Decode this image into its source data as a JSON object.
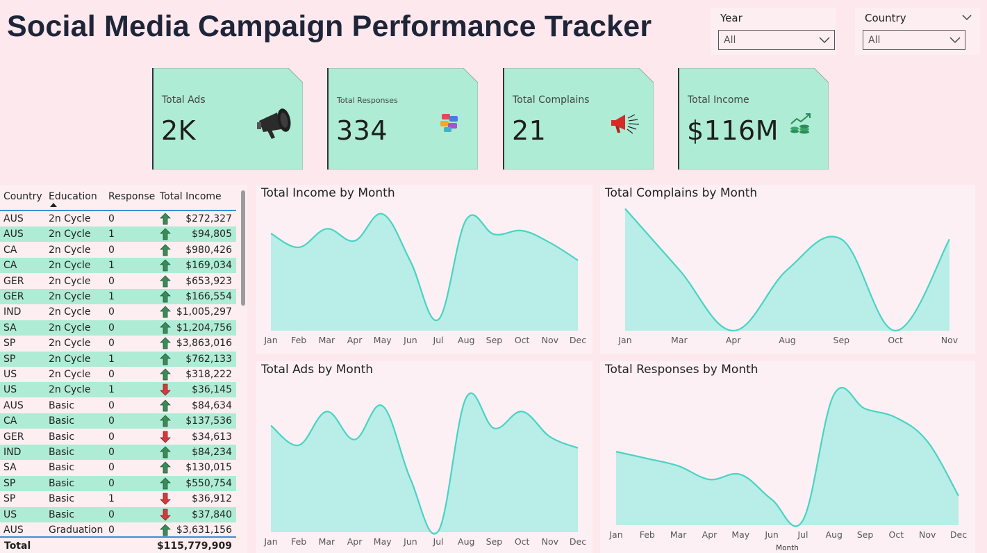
{
  "title": "Social Media Campaign Performance Tracker",
  "slicers": {
    "year": {
      "label": "Year",
      "value": "All"
    },
    "country": {
      "label": "Country",
      "value": "All"
    }
  },
  "kpis": [
    {
      "label": "Total Ads",
      "value": "2K",
      "icon": "megaphone-icon"
    },
    {
      "label": "Total Responses",
      "value": "334",
      "icon": "chat-bubbles-icon"
    },
    {
      "label": "Total Complains",
      "value": "21",
      "icon": "loudspeaker-icon"
    },
    {
      "label": "Total Income",
      "value": "$116M",
      "icon": "money-growth-icon"
    }
  ],
  "table": {
    "columns": [
      "Country",
      "Education",
      "Response",
      "Total Income"
    ],
    "rows": [
      {
        "country": "AUS",
        "education": "2n Cycle",
        "response": "0",
        "income": "$272,327",
        "trend": "up"
      },
      {
        "country": "AUS",
        "education": "2n Cycle",
        "response": "1",
        "income": "$94,805",
        "trend": "up"
      },
      {
        "country": "CA",
        "education": "2n Cycle",
        "response": "0",
        "income": "$980,426",
        "trend": "up"
      },
      {
        "country": "CA",
        "education": "2n Cycle",
        "response": "1",
        "income": "$169,034",
        "trend": "up"
      },
      {
        "country": "GER",
        "education": "2n Cycle",
        "response": "0",
        "income": "$653,923",
        "trend": "up"
      },
      {
        "country": "GER",
        "education": "2n Cycle",
        "response": "1",
        "income": "$166,554",
        "trend": "up"
      },
      {
        "country": "IND",
        "education": "2n Cycle",
        "response": "0",
        "income": "$1,005,297",
        "trend": "up"
      },
      {
        "country": "SA",
        "education": "2n Cycle",
        "response": "0",
        "income": "$1,204,756",
        "trend": "up"
      },
      {
        "country": "SP",
        "education": "2n Cycle",
        "response": "0",
        "income": "$3,863,016",
        "trend": "up"
      },
      {
        "country": "SP",
        "education": "2n Cycle",
        "response": "1",
        "income": "$762,133",
        "trend": "up"
      },
      {
        "country": "US",
        "education": "2n Cycle",
        "response": "0",
        "income": "$318,222",
        "trend": "up"
      },
      {
        "country": "US",
        "education": "2n Cycle",
        "response": "1",
        "income": "$36,145",
        "trend": "down"
      },
      {
        "country": "AUS",
        "education": "Basic",
        "response": "0",
        "income": "$84,634",
        "trend": "up"
      },
      {
        "country": "CA",
        "education": "Basic",
        "response": "0",
        "income": "$137,536",
        "trend": "up"
      },
      {
        "country": "GER",
        "education": "Basic",
        "response": "0",
        "income": "$34,613",
        "trend": "down"
      },
      {
        "country": "IND",
        "education": "Basic",
        "response": "0",
        "income": "$84,234",
        "trend": "up"
      },
      {
        "country": "SA",
        "education": "Basic",
        "response": "0",
        "income": "$130,015",
        "trend": "up"
      },
      {
        "country": "SP",
        "education": "Basic",
        "response": "0",
        "income": "$550,754",
        "trend": "up"
      },
      {
        "country": "SP",
        "education": "Basic",
        "response": "1",
        "income": "$36,912",
        "trend": "down"
      },
      {
        "country": "US",
        "education": "Basic",
        "response": "0",
        "income": "$37,840",
        "trend": "down"
      },
      {
        "country": "AUS",
        "education": "Graduation",
        "response": "0",
        "income": "$3,631,156",
        "trend": "up"
      }
    ],
    "total_label": "Total",
    "total_value": "$115,779,909"
  },
  "colors": {
    "accent": "#49d3c3",
    "area": "#b9ede7",
    "kpi_card": "#aeecd6",
    "background": "#fde8ee",
    "up": "#3c8a5a",
    "down": "#d23b3b"
  },
  "chart_data": [
    {
      "type": "area",
      "title": "Total Income by Month",
      "categories": [
        "Jan",
        "Feb",
        "Mar",
        "Apr",
        "May",
        "Jun",
        "Jul",
        "Aug",
        "Sep",
        "Oct",
        "Nov",
        "Dec"
      ],
      "values": [
        10.5,
        9.0,
        11.0,
        9.7,
        12.6,
        7.5,
        1.2,
        12.0,
        10.4,
        10.8,
        9.5,
        7.6
      ],
      "ylim": [
        0,
        13.5
      ],
      "xlabel": "",
      "ylabel": ""
    },
    {
      "type": "area",
      "title": "Total Complains by Month",
      "categories": [
        "Jan",
        "Mar",
        "Apr",
        "Aug",
        "Sep",
        "Oct",
        "Nov"
      ],
      "values": [
        4,
        2,
        0,
        2,
        3,
        0,
        3
      ],
      "ylim": [
        0,
        4.1
      ],
      "xlabel": "",
      "ylabel": ""
    },
    {
      "type": "area",
      "title": "Total Ads by Month",
      "categories": [
        "Jan",
        "Feb",
        "Mar",
        "Apr",
        "May",
        "Jun",
        "Jul",
        "Aug",
        "Sep",
        "Oct",
        "Nov",
        "Dec"
      ],
      "values": [
        190,
        155,
        215,
        165,
        225,
        95,
        2,
        240,
        185,
        215,
        170,
        150
      ],
      "ylim": [
        0,
        260
      ],
      "xlabel": "",
      "ylabel": ""
    },
    {
      "type": "area",
      "title": "Total Responses by Month",
      "categories": [
        "Jan",
        "Feb",
        "Mar",
        "Apr",
        "May",
        "Jun",
        "Jul",
        "Aug",
        "Sep",
        "Oct",
        "Nov",
        "Dec"
      ],
      "values": [
        18,
        16.3,
        14.5,
        11.2,
        12.4,
        6.3,
        1.2,
        32,
        28.5,
        26.3,
        20.5,
        7.2
      ],
      "ylim": [
        0,
        34
      ],
      "xlabel": "Month",
      "ylabel": ""
    }
  ]
}
